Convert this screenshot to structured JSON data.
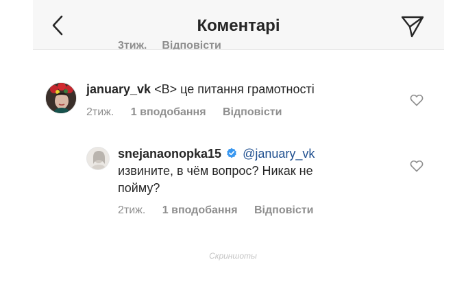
{
  "header": {
    "title": "Коментарі",
    "peek": {
      "time": "3тиж.",
      "reply": "Відповісти"
    }
  },
  "comments": [
    {
      "username": "january_vk",
      "text": "<В> це питання грамотності",
      "time": "2тиж.",
      "likes": "1 вподобання",
      "reply": "Відповісти"
    },
    {
      "username": "snejanaonopka15",
      "mention": "@january_vk",
      "text": "извините, в чём вопрос? Никак не пойму?",
      "time": "2тиж.",
      "likes": "1 вподобання",
      "reply": "Відповісти"
    }
  ],
  "watermark": "Скриншоты",
  "colors": {
    "verified": "#3897f0",
    "mention": "#1f4f8f",
    "muted": "#8e8e8e"
  },
  "icons": [
    "back-arrow-icon",
    "send-icon",
    "heart-icon",
    "verified-badge-icon"
  ]
}
